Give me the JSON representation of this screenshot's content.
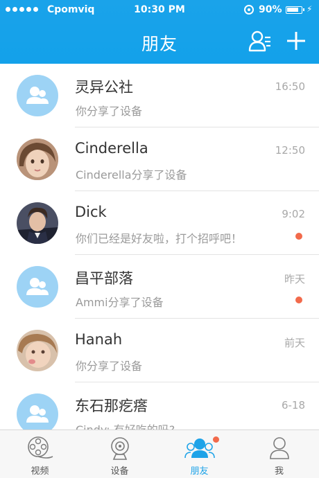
{
  "status_bar": {
    "carrier": "Cpomviq",
    "time": "10:30 PM",
    "battery": "90%"
  },
  "header": {
    "title": "朋友",
    "contacts_icon": "contacts-list-icon",
    "add_icon": "plus-icon"
  },
  "conversations": [
    {
      "name": "灵异公社",
      "message": "你分享了设备",
      "time": "16:50",
      "avatar": "group-icon",
      "unread": false
    },
    {
      "name": "Cinderella",
      "message": "Cinderella分享了设备",
      "time": "12:50",
      "avatar": "photo",
      "unread": false
    },
    {
      "name": "Dick",
      "message": "你们已经是好友啦，打个招呼吧！",
      "time": "9:02",
      "avatar": "photo",
      "unread": true
    },
    {
      "name": "昌平部落",
      "message": "Ammi分享了设备",
      "time": "昨天",
      "avatar": "group-icon",
      "unread": true
    },
    {
      "name": "Hanah",
      "message": "你分享了设备",
      "time": "前天",
      "avatar": "photo",
      "unread": false
    },
    {
      "name": "东石那疙瘩",
      "message": "Cindy: 有好吃的吗?",
      "time": "6-18",
      "avatar": "group-icon",
      "unread": false
    }
  ],
  "tabs": [
    {
      "label": "视频",
      "icon": "film-reel-icon",
      "active": false
    },
    {
      "label": "设备",
      "icon": "camera-device-icon",
      "active": false
    },
    {
      "label": "朋友",
      "icon": "friends-icon",
      "active": true
    },
    {
      "label": "我",
      "icon": "person-icon",
      "active": false
    }
  ],
  "colors": {
    "accent": "#1aa3ea",
    "badge": "#f26a4b",
    "group_avatar": "#9dd3f5"
  }
}
